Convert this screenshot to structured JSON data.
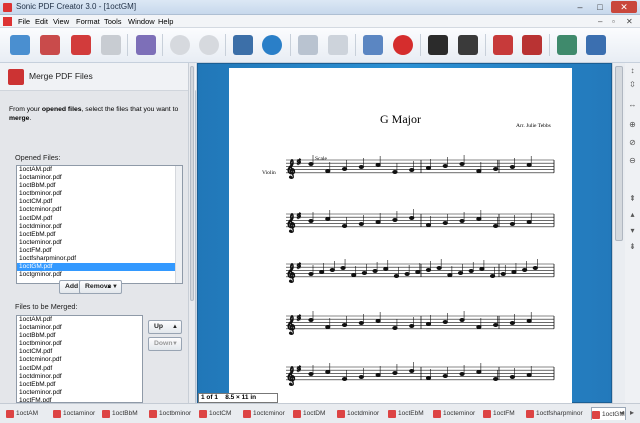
{
  "window": {
    "title": "Sonic PDF Creator 3.0 - [1octGM]"
  },
  "menu": [
    "File",
    "Edit",
    "View",
    "Format",
    "Tools",
    "Window",
    "Help"
  ],
  "toolbar": {
    "icons": [
      "new-icon",
      "open-icon",
      "open-folder-icon",
      "save-icon",
      "convert-icon",
      "undo-icon",
      "redo-icon",
      "scan-icon",
      "link-icon",
      "insert-pages-icon",
      "extract-pages-icon",
      "merge-icon",
      "key-icon",
      "security-icon",
      "stamp-icon",
      "print-icon",
      "printer-icon",
      "sign-icon",
      "attach-icon"
    ]
  },
  "left": {
    "header": "Merge PDF Files",
    "desc_a": "From your ",
    "desc_b": "opened files",
    "desc_c": ", select the files that you want to ",
    "desc_d": "merge",
    "desc_e": ".",
    "opened_label": "Opened Files:",
    "opened_files": [
      "1octAM.pdf",
      "1octaminor.pdf",
      "1octBbM.pdf",
      "1octbminor.pdf",
      "1octCM.pdf",
      "1octcminor.pdf",
      "1octDM.pdf",
      "1octdminor.pdf",
      "1octEbM.pdf",
      "1octeminor.pdf",
      "1octFM.pdf",
      "1octfsharpminor.pdf",
      "1octGM.pdf",
      "1octgminor.pdf"
    ],
    "opened_selected": 12,
    "add_label": "Add",
    "remove_label": "Remove",
    "merge_label": "Files to be Merged:",
    "merge_files": [
      "1octAM.pdf",
      "1octaminor.pdf",
      "1octBbM.pdf",
      "1octbminor.pdf",
      "1octCM.pdf",
      "1octcminor.pdf",
      "1octDM.pdf",
      "1octdminor.pdf",
      "1octEbM.pdf",
      "1octeminor.pdf",
      "1octFM.pdf",
      "1octfsharpminor.pdf"
    ],
    "merge_selected": 11,
    "up_label": "Up",
    "down_label": "Down"
  },
  "doc": {
    "title": "G Major",
    "arranger": "Arr. Julie Tebbs",
    "instrument": "Violin",
    "scale_label": "Scale",
    "page_of": "1 of 1",
    "page_size": "8.5 × 11 in"
  },
  "tabs": [
    "1octAM",
    "1octaminor",
    "1octBbM",
    "1octbminor",
    "1octCM",
    "1octcminor",
    "1octDM",
    "1octdminor",
    "1octEbM",
    "1octeminor",
    "1octFM",
    "1octfsharpminor",
    "1octGM"
  ],
  "active_tab": 12,
  "colors": {
    "accent": "#d33",
    "doc_bg": "#2b91d4",
    "selection": "#3399ff"
  }
}
